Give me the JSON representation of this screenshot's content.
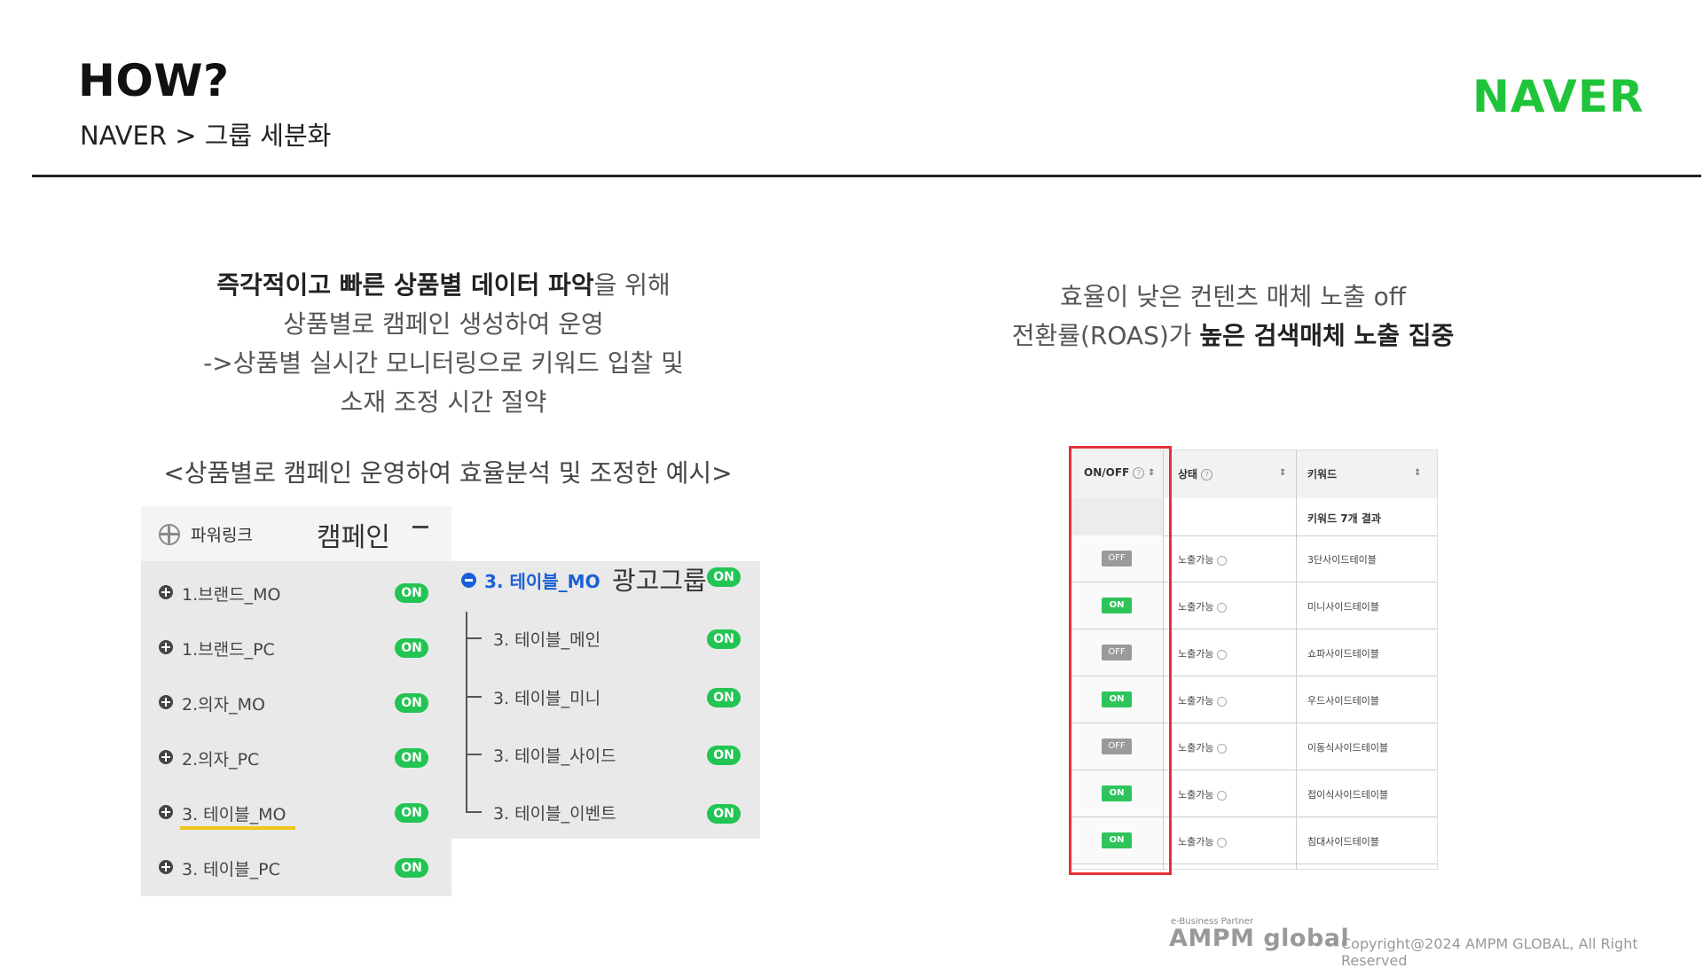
{
  "header": {
    "title": "HOW?",
    "subtitle": "NAVER > 그룹 세분화",
    "brand": "NAVER"
  },
  "left": {
    "desc": [
      {
        "bold": "즉각적이고 빠른 상품별 데이터 파악",
        "rest": "을 위해"
      },
      {
        "bold": "",
        "rest": "상품별로 캠페인 생성하여 운영"
      },
      {
        "bold": "",
        "rest": "->상품별 실시간 모니터링으로 키워드 입찰 및"
      },
      {
        "bold": "",
        "rest": "소재 조정 시간 절약"
      }
    ],
    "caption": "<상품별로 캠페인 운영하여 효율분석 및 조정한 예시>"
  },
  "campaign_panel": {
    "powerlink": "파워링크",
    "campaign": "캠페인",
    "items": [
      {
        "label": "1.브랜드_MO",
        "status": "ON"
      },
      {
        "label": "1.브랜드_PC",
        "status": "ON"
      },
      {
        "label": "2.의자_MO",
        "status": "ON"
      },
      {
        "label": "2.의자_PC",
        "status": "ON"
      },
      {
        "label": "3. 테이블_MO",
        "status": "ON"
      },
      {
        "label": "3. 테이블_PC",
        "status": "ON"
      }
    ]
  },
  "adgroup_panel": {
    "title_a": "3. 테이블_MO",
    "title_b": "광고그룹",
    "title_status": "ON",
    "items": [
      {
        "label": "3. 테이블_메인",
        "status": "ON"
      },
      {
        "label": "3. 테이블_미니",
        "status": "ON"
      },
      {
        "label": "3. 테이블_사이드",
        "status": "ON"
      },
      {
        "label": "3. 테이블_이벤트",
        "status": "ON"
      }
    ]
  },
  "right": {
    "line1": "효율이 낮은 컨텐츠 매체 노출 off",
    "line2_pre": "전환률(ROAS)가 ",
    "line2_bold": "높은 검색매체 노출 집중"
  },
  "table": {
    "col_onoff": "ON/OFF",
    "col_status": "상태",
    "col_keyword": "키워드",
    "summary": "키워드 7개 결과",
    "rows": [
      {
        "toggle": "OFF",
        "status": "노출가능",
        "keyword": "3단사이드테이블"
      },
      {
        "toggle": "ON",
        "status": "노출가능",
        "keyword": "미니사이드테이블"
      },
      {
        "toggle": "OFF",
        "status": "노출가능",
        "keyword": "쇼파사이드테이블"
      },
      {
        "toggle": "ON",
        "status": "노출가능",
        "keyword": "우드사이드테이블"
      },
      {
        "toggle": "OFF",
        "status": "노출가능",
        "keyword": "이동식사이드테이블"
      },
      {
        "toggle": "ON",
        "status": "노출가능",
        "keyword": "접이식사이드테이블"
      },
      {
        "toggle": "ON",
        "status": "노출가능",
        "keyword": "침대사이드테이블"
      }
    ]
  },
  "footer": {
    "partner": "e-Business Partner",
    "logo": "AMPM global",
    "copyright": "Copyright@2024 AMPM GLOBAL, All Right Reserved"
  }
}
